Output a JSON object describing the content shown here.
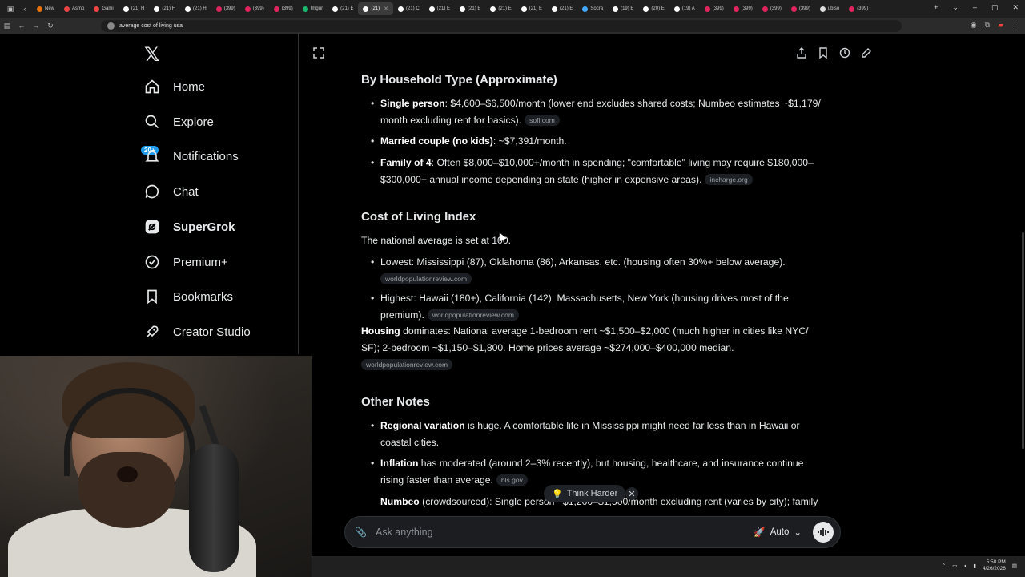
{
  "browser": {
    "tabs": [
      {
        "label": "New",
        "color": "#e8710a"
      },
      {
        "label": "Asmo",
        "color": "#e44"
      },
      {
        "label": "Gami",
        "color": "#e44"
      },
      {
        "label": "(21) H",
        "color": "#fff"
      },
      {
        "label": "(21) H",
        "color": "#fff"
      },
      {
        "label": "(21) H",
        "color": "#fff"
      },
      {
        "label": "(399)",
        "color": "#e0245e"
      },
      {
        "label": "(399)",
        "color": "#e0245e"
      },
      {
        "label": "(399)",
        "color": "#e0245e"
      },
      {
        "label": "Imgur",
        "color": "#1bb76e"
      },
      {
        "label": "(21) E",
        "color": "#fff"
      },
      {
        "label": "(21)",
        "color": "#fff",
        "active": true
      },
      {
        "label": "(21) C",
        "color": "#fff"
      },
      {
        "label": "(21) E",
        "color": "#fff"
      },
      {
        "label": "(21) E",
        "color": "#fff"
      },
      {
        "label": "(21) E",
        "color": "#fff"
      },
      {
        "label": "(21) E",
        "color": "#fff"
      },
      {
        "label": "(21) E",
        "color": "#fff"
      },
      {
        "label": "Socra",
        "color": "#4af"
      },
      {
        "label": "(19) E",
        "color": "#fff"
      },
      {
        "label": "(20) E",
        "color": "#fff"
      },
      {
        "label": "(19) A",
        "color": "#fff"
      },
      {
        "label": "(399)",
        "color": "#e0245e"
      },
      {
        "label": "(399)",
        "color": "#e0245e"
      },
      {
        "label": "(399)",
        "color": "#e0245e"
      },
      {
        "label": "(399)",
        "color": "#e0245e"
      },
      {
        "label": "ubiso",
        "color": "#ddd"
      },
      {
        "label": "(399)",
        "color": "#e0245e"
      }
    ],
    "url": "average cost of living usa"
  },
  "sidebar": {
    "items": [
      {
        "label": "Home",
        "icon": "home-icon"
      },
      {
        "label": "Explore",
        "icon": "search-icon"
      },
      {
        "label": "Notifications",
        "icon": "bell-icon",
        "badge": "20+"
      },
      {
        "label": "Chat",
        "icon": "chat-icon"
      },
      {
        "label": "SuperGrok",
        "icon": "grok-icon",
        "bold": true
      },
      {
        "label": "Premium+",
        "icon": "verified-icon"
      },
      {
        "label": "Bookmarks",
        "icon": "bookmark-icon"
      },
      {
        "label": "Creator Studio",
        "icon": "rocket-icon"
      }
    ]
  },
  "grok": {
    "section1": {
      "title": "By Household Type (Approximate)",
      "b1_bold": "Single person",
      "b1_text": ": $4,600–$6,500/month (lower end excludes shared costs; Numbeo estimates ~$1,179/ month excluding rent for basics).",
      "b1_src": "sofi.com",
      "b2_bold": "Married couple (no kids)",
      "b2_text": ": ~$7,391/month.",
      "b3_bold": "Family of 4",
      "b3_text": ": Often $8,000–$10,000+/month in spending; \"comfortable\" living may require $180,000– $300,000+ annual income depending on state (higher in expensive areas).",
      "b3_src": "incharge.org"
    },
    "section2": {
      "title": "Cost of Living Index",
      "intro": "The national average is set at 100.",
      "b1_text": "Lowest: Mississippi (87), Oklahoma (86), Arkansas, etc. (housing often 30%+ below average).",
      "b1_src": "worldpopulationreview.com",
      "b2_text": "Highest: Hawaii (180+), California (142), Massachusetts, New York (housing drives most of the premium).",
      "b2_src": "worldpopulationreview.com",
      "housing_bold": "Housing",
      "housing_text": " dominates: National average 1-bedroom rent ~$1,500–$2,000 (much higher in cities like NYC/ SF); 2-bedroom ~$1,150–$1,800. Home prices average ~$274,000–$400,000 median.",
      "housing_src": "worldpopulationreview.com"
    },
    "section3": {
      "title": "Other Notes",
      "b1_bold": "Regional variation",
      "b1_text": " is huge. A comfortable life in Mississippi might need far less than in Hawaii or coastal cities.",
      "b2_bold": "Inflation",
      "b2_text": " has moderated (around 2–3% recently), but housing, healthcare, and insurance continue rising faster than average.",
      "b2_src": "bls.gov",
      "b3_bold": "Numbeo",
      "b3_text": " (crowdsourced): Single person ~$1,200–$1,500/month excluding rent (varies by city); family"
    },
    "think_label": "Think Harder",
    "input_placeholder": "Ask anything",
    "mode_label": "Auto"
  },
  "taskbar": {
    "time": "5:58 PM",
    "date": "4/26/2026"
  }
}
